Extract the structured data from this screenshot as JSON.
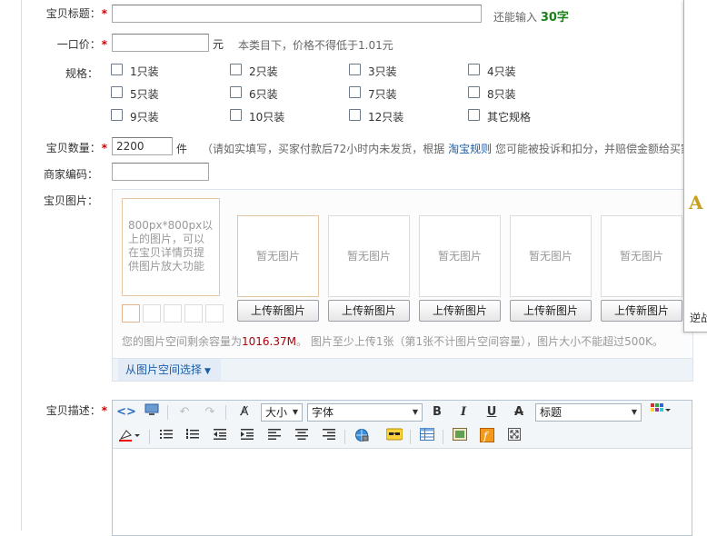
{
  "title_field": {
    "label": "宝贝标题：",
    "value": "",
    "hint_prefix": "还能输入",
    "hint_count": "30字"
  },
  "price_field": {
    "label": "一口价：",
    "value": "",
    "unit": "元",
    "hint": "本类目下，价格不得低于1.01元"
  },
  "spec": {
    "label": "规格：",
    "options": [
      "1只装",
      "2只装",
      "3只装",
      "4只装",
      "5只装",
      "6只装",
      "7只装",
      "8只装",
      "9只装",
      "10只装",
      "12只装",
      "其它规格"
    ]
  },
  "quantity_field": {
    "label": "宝贝数量：",
    "value": "2200",
    "unit": "件",
    "hint_before": "（请如实填写，买家付款后72小时内未发货，根据",
    "hint_link": "淘宝规则",
    "hint_after": "您可能被投诉和扣分，并赔偿金额给买家"
  },
  "merchant_code": {
    "label": "商家编码：",
    "value": ""
  },
  "photos": {
    "label": "宝贝图片：",
    "main_text": "800px*800px以上的图片，可以在宝贝详情页提供图片放大功能",
    "slot_text": "暂无图片",
    "upload_label": "上传新图片",
    "space_prefix": "您的图片空间剩余容量为",
    "space_value": "1016.37M",
    "space_suffix": "。 图片至少上传1张（第1张不计图片空间容量），图片大小不能超过500K。",
    "choose_label": "从图片空间选择"
  },
  "description": {
    "label": "宝贝描述：",
    "size_label": "大小",
    "font_label": "字体",
    "heading_label": "标题"
  },
  "side_panel": {
    "letter": "A",
    "text": "逆战"
  }
}
